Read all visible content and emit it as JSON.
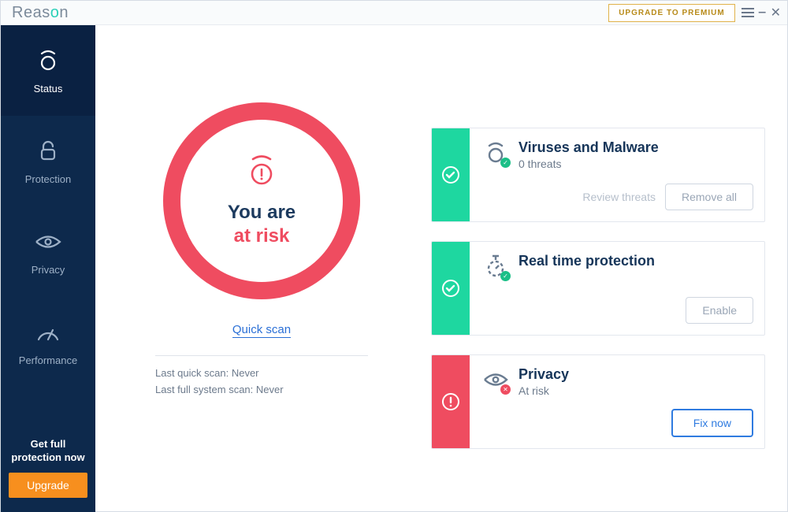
{
  "topbar": {
    "brand_pre": "Reas",
    "brand_o": "o",
    "brand_post": "n",
    "upgrade_label": "UPGRADE TO PREMIUM"
  },
  "sidebar": {
    "items": [
      {
        "label": "Status"
      },
      {
        "label": "Protection"
      },
      {
        "label": "Privacy"
      },
      {
        "label": "Performance"
      }
    ],
    "cta_line1": "Get full",
    "cta_line2": "protection now",
    "cta_button": "Upgrade"
  },
  "status": {
    "title_line1": "You are",
    "title_line2": "at risk",
    "quick_scan": "Quick scan",
    "last_quick_label": "Last quick scan: ",
    "last_quick_value": "Never",
    "last_full_label": "Last full system scan: ",
    "last_full_value": "Never"
  },
  "cards": {
    "viruses": {
      "title": "Viruses and Malware",
      "subtitle": "0 threats",
      "review": "Review threats",
      "remove": "Remove all"
    },
    "realtime": {
      "title": "Real time protection",
      "enable": "Enable"
    },
    "privacy": {
      "title": "Privacy",
      "subtitle": "At risk",
      "fix": "Fix now"
    }
  }
}
